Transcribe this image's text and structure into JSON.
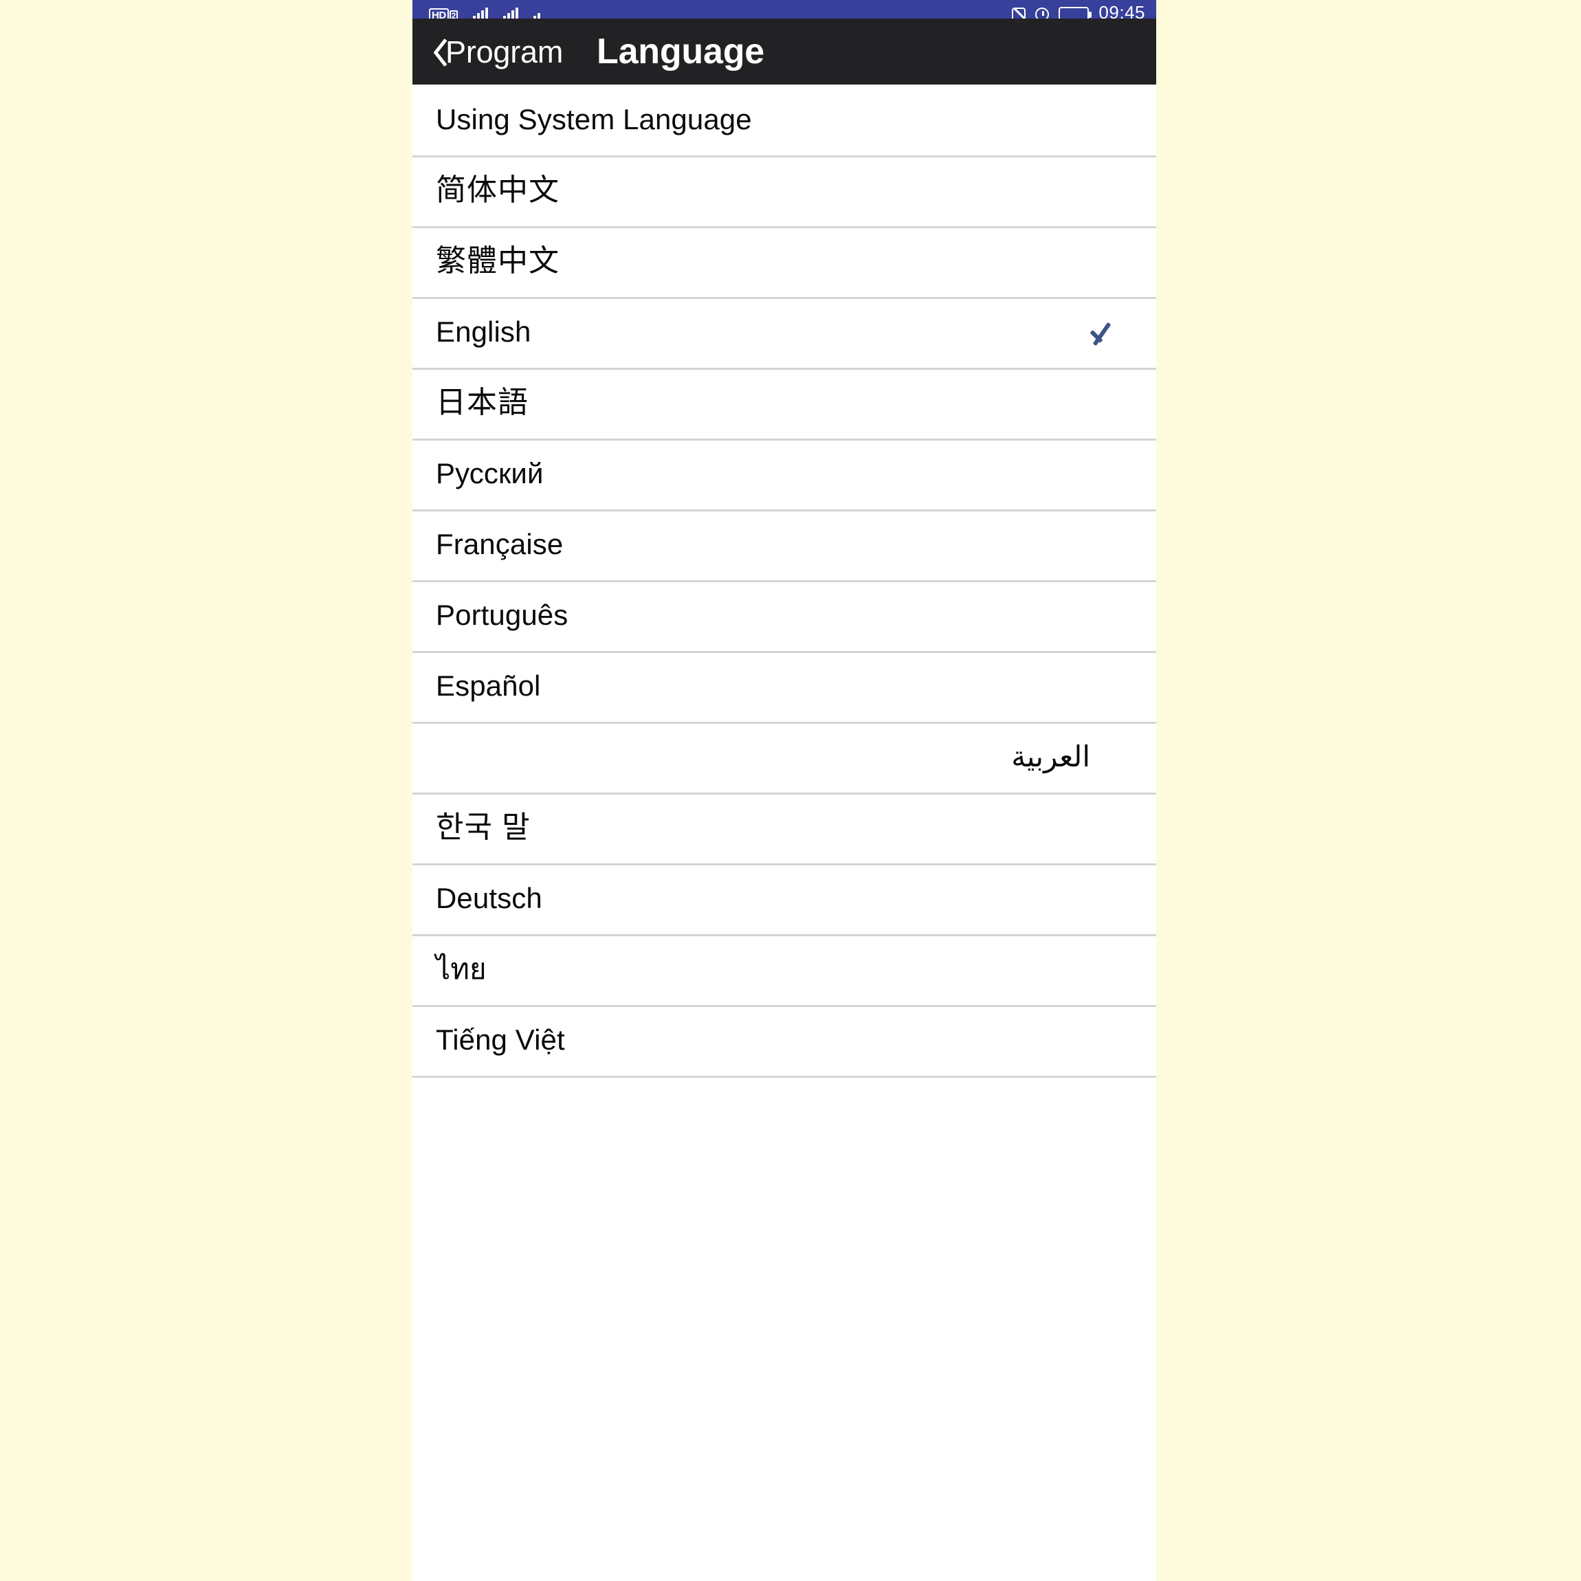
{
  "background_color": "#FDFBDC",
  "status_bar": {
    "background_color": "#37409A",
    "hd_label": "HD",
    "hd_sub": "2",
    "time": "09:45",
    "icons": [
      "hd-badge-icon",
      "signal-bars-icon",
      "signal-bars-secondary-icon",
      "data-transfer-icon",
      "no-sound-icon",
      "alarm-clock-icon",
      "battery-icon"
    ]
  },
  "nav_bar": {
    "background_color": "#222224",
    "back_label": "Program",
    "title": "Language"
  },
  "list": {
    "selected_index": 3,
    "check_color": "#3C5488",
    "divider_color": "#D4D4D4",
    "items": [
      {
        "label": "Using System Language",
        "dir": "ltr",
        "script": "latin"
      },
      {
        "label": "简体中文",
        "dir": "ltr",
        "script": "cjk"
      },
      {
        "label": "繁體中文",
        "dir": "ltr",
        "script": "cjk"
      },
      {
        "label": "English",
        "dir": "ltr",
        "script": "latin"
      },
      {
        "label": "日本語",
        "dir": "ltr",
        "script": "cjk"
      },
      {
        "label": "Русский",
        "dir": "ltr",
        "script": "cyrillic"
      },
      {
        "label": "Française",
        "dir": "ltr",
        "script": "latin"
      },
      {
        "label": "Português",
        "dir": "ltr",
        "script": "latin"
      },
      {
        "label": "Español",
        "dir": "ltr",
        "script": "latin"
      },
      {
        "label": "العربية",
        "dir": "rtl",
        "script": "arabic"
      },
      {
        "label": "한국 말",
        "dir": "ltr",
        "script": "cjk"
      },
      {
        "label": "Deutsch",
        "dir": "ltr",
        "script": "latin"
      },
      {
        "label": "ไทย",
        "dir": "ltr",
        "script": "thai"
      },
      {
        "label": "Tiếng Việt",
        "dir": "ltr",
        "script": "latin"
      }
    ]
  }
}
